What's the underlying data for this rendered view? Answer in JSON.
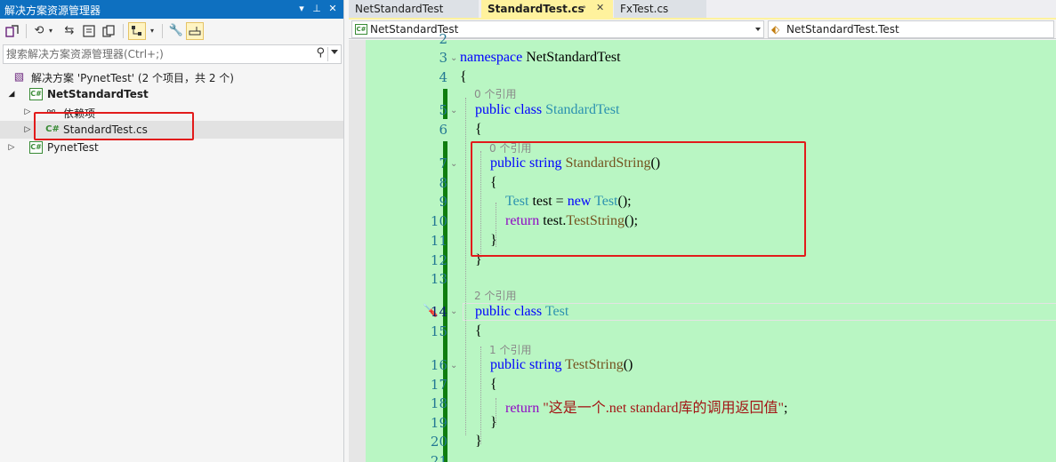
{
  "solution_explorer": {
    "title": "解决方案资源管理器",
    "title_buttons": {
      "dropdown": "▾",
      "pin": "⊥",
      "close": "✕"
    },
    "search_placeholder": "搜索解决方案资源管理器(Ctrl+;)",
    "tree": [
      {
        "label": "解决方案 'PynetTest' (2 个项目，共 2 个)",
        "icon": "solution-icon",
        "expander": ""
      },
      {
        "label": "NetStandardTest",
        "icon": "csharp-project-icon",
        "expander": "◢",
        "bold": true
      },
      {
        "label": "依赖项",
        "icon": "dependencies-icon",
        "expander": "▷"
      },
      {
        "label": "StandardTest.cs",
        "icon": "csharp-file-icon",
        "expander": "▷"
      },
      {
        "label": "PynetTest",
        "icon": "csharp-project-icon",
        "expander": "▷"
      }
    ]
  },
  "editor": {
    "tabs": [
      {
        "label": "NetStandardTest",
        "active": false
      },
      {
        "label": "StandardTest.cs",
        "active": true,
        "pin": "⊸",
        "close": "✕"
      },
      {
        "label": "FxTest.cs",
        "active": false
      }
    ],
    "nav_left": "NetStandardTest",
    "nav_right": "NetStandardTest.Test",
    "references": {
      "ref0a": "0 个引用",
      "ref0b": "0 个引用",
      "ref2": "2 个引用",
      "ref1": "1 个引用"
    },
    "code_lines": [
      {
        "n": "2",
        "tokens": []
      },
      {
        "n": "3",
        "tokens": [
          [
            "kw",
            "namespace"
          ],
          [
            "",
            "NetStandardTest"
          ]
        ]
      },
      {
        "n": "4",
        "tokens": [
          [
            "",
            "{"
          ]
        ]
      },
      {
        "n": "5",
        "tokens": [
          [
            "kw",
            "public"
          ],
          [
            "kw",
            "class"
          ],
          [
            "cls",
            "StandardTest"
          ]
        ]
      },
      {
        "n": "6",
        "tokens": [
          [
            "",
            "{"
          ]
        ]
      },
      {
        "n": "7",
        "tokens": [
          [
            "kw",
            "public"
          ],
          [
            "kw",
            "string"
          ],
          [
            "mth",
            "StandardString"
          ],
          [
            "",
            "()"
          ]
        ]
      },
      {
        "n": "8",
        "tokens": [
          [
            "",
            "{"
          ]
        ]
      },
      {
        "n": "9",
        "tokens": [
          [
            "cls",
            "Test"
          ],
          [
            "",
            "test ="
          ],
          [
            "kw",
            "new"
          ],
          [
            "cls",
            "Test"
          ],
          [
            "",
            "();"
          ]
        ]
      },
      {
        "n": "10",
        "tokens": [
          [
            "ctl",
            "return"
          ],
          [
            "",
            "test."
          ],
          [
            "mth",
            "TestString"
          ],
          [
            "",
            "();"
          ]
        ]
      },
      {
        "n": "11",
        "tokens": [
          [
            "",
            "}"
          ]
        ]
      },
      {
        "n": "12",
        "tokens": [
          [
            "",
            "}"
          ]
        ]
      },
      {
        "n": "13",
        "tokens": []
      },
      {
        "n": "14",
        "tokens": [
          [
            "kw",
            "public"
          ],
          [
            "kw",
            "class"
          ],
          [
            "cls",
            "Test"
          ]
        ]
      },
      {
        "n": "15",
        "tokens": [
          [
            "",
            "{"
          ]
        ]
      },
      {
        "n": "16",
        "tokens": [
          [
            "kw",
            "public"
          ],
          [
            "kw",
            "string"
          ],
          [
            "mth",
            "TestString"
          ],
          [
            "",
            "()"
          ]
        ]
      },
      {
        "n": "17",
        "tokens": [
          [
            "",
            "{"
          ]
        ]
      },
      {
        "n": "18",
        "tokens": [
          [
            "ctl",
            "return"
          ],
          [
            "str",
            "\"这是一个.net standard库的调用返回值\""
          ],
          [
            "",
            ";"
          ]
        ]
      },
      {
        "n": "19",
        "tokens": [
          [
            "",
            "}"
          ]
        ]
      },
      {
        "n": "20",
        "tokens": [
          [
            "",
            "}"
          ]
        ]
      },
      {
        "n": "21",
        "tokens": []
      }
    ]
  }
}
